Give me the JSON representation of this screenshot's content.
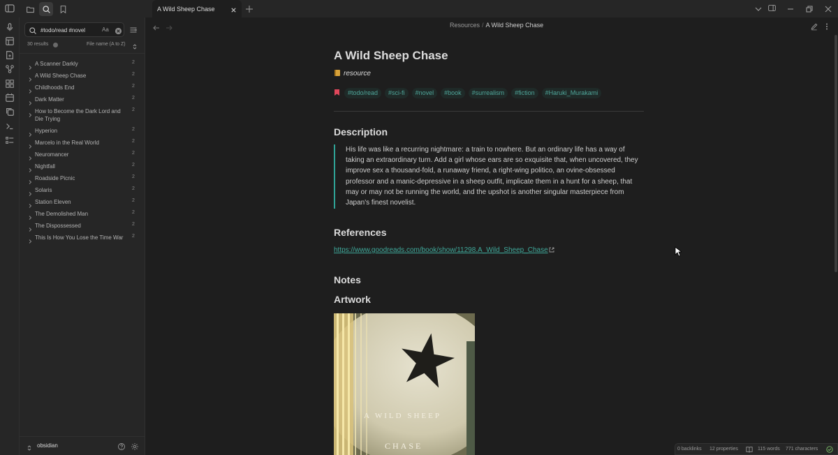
{
  "tab": {
    "title": "A Wild Sheep Chase"
  },
  "sidebar": {
    "search_value": "#todo/read #novel",
    "match_case_label": "Aa",
    "results_count": "30 results",
    "sort_label": "File name (A to Z)",
    "results": [
      {
        "name": "A Scanner Darkly",
        "count": "2"
      },
      {
        "name": "A Wild Sheep Chase",
        "count": "2"
      },
      {
        "name": "Childhoods End",
        "count": "2"
      },
      {
        "name": "Dark Matter",
        "count": "2"
      },
      {
        "name": "How to Become the Dark Lord and Die Trying",
        "count": "2"
      },
      {
        "name": "Hyperion",
        "count": "2"
      },
      {
        "name": "Marcelo in the Real World",
        "count": "2"
      },
      {
        "name": "Neuromancer",
        "count": "2"
      },
      {
        "name": "Nightfall",
        "count": "2"
      },
      {
        "name": "Roadside Picnic",
        "count": "2"
      },
      {
        "name": "Solaris",
        "count": "2"
      },
      {
        "name": "Station Eleven",
        "count": "2"
      },
      {
        "name": "The Demolished Man",
        "count": "2"
      },
      {
        "name": "The Dispossessed",
        "count": "2"
      },
      {
        "name": "This Is How You Lose the Time War",
        "count": "2"
      }
    ],
    "vault_name": "obsidian"
  },
  "breadcrumb": {
    "folder": "Resources",
    "separator": "/",
    "note": "A Wild Sheep Chase"
  },
  "note": {
    "title": "A Wild Sheep Chase",
    "category": "resource",
    "tags": [
      "#todo/read",
      "#sci-fi",
      "#novel",
      "#book",
      "#surrealism",
      "#fiction",
      "#Haruki_Murakami"
    ],
    "description_heading": "Description",
    "description": "His life was like a recurring nightmare: a train to nowhere. But an ordinary life has a way of taking an extraordinary turn. Add a girl whose ears are so exquisite that, when uncovered, they improve sex a thousand-fold, a runaway friend, a right-wing politico, an ovine-obsessed professor and a manic-depressive in a sheep outfit, implicate them in a hunt for a sheep, that may or may not be running the world, and the upshot is another singular masterpiece from Japan's finest novelist.",
    "references_heading": "References",
    "reference_link": "https://www.goodreads.com/book/show/11298.A_Wild_Sheep_Chase",
    "notes_heading": "Notes",
    "artwork_heading": "Artwork",
    "cover_line1": "A WILD SHEEP",
    "cover_line2": "CHASE"
  },
  "status": {
    "backlinks": "0 backlinks",
    "properties": "12 properties",
    "words": "115 words",
    "characters": "771 characters"
  }
}
